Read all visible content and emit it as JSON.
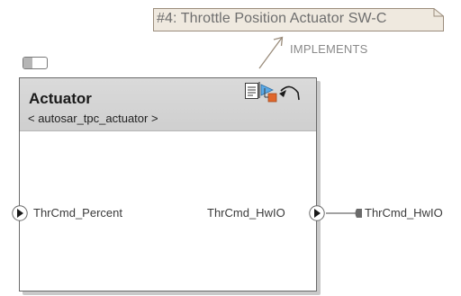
{
  "requirement": {
    "label": "#4: Throttle Position Actuator SW-C"
  },
  "link": {
    "label": "IMPLEMENTS"
  },
  "component": {
    "name": "Actuator",
    "stereotype": "< autosar_tpc_actuator >",
    "icons": [
      "document-icon",
      "requirement-icon",
      "hierarchy-icon",
      "arrow-curve-icon"
    ]
  },
  "ports": {
    "input": {
      "label": "ThrCmd_Percent"
    },
    "output": {
      "label": "ThrCmd_HwIO"
    },
    "external": {
      "label": "ThrCmd_HwIO"
    }
  },
  "colors": {
    "block_border": "#6a6a6a",
    "header_fill": "#d4d4d4",
    "note_fill": "#efe9df",
    "note_border": "#9b8d7c",
    "link_color": "#9b8d7c",
    "port_fill": "#1a1a1a"
  }
}
